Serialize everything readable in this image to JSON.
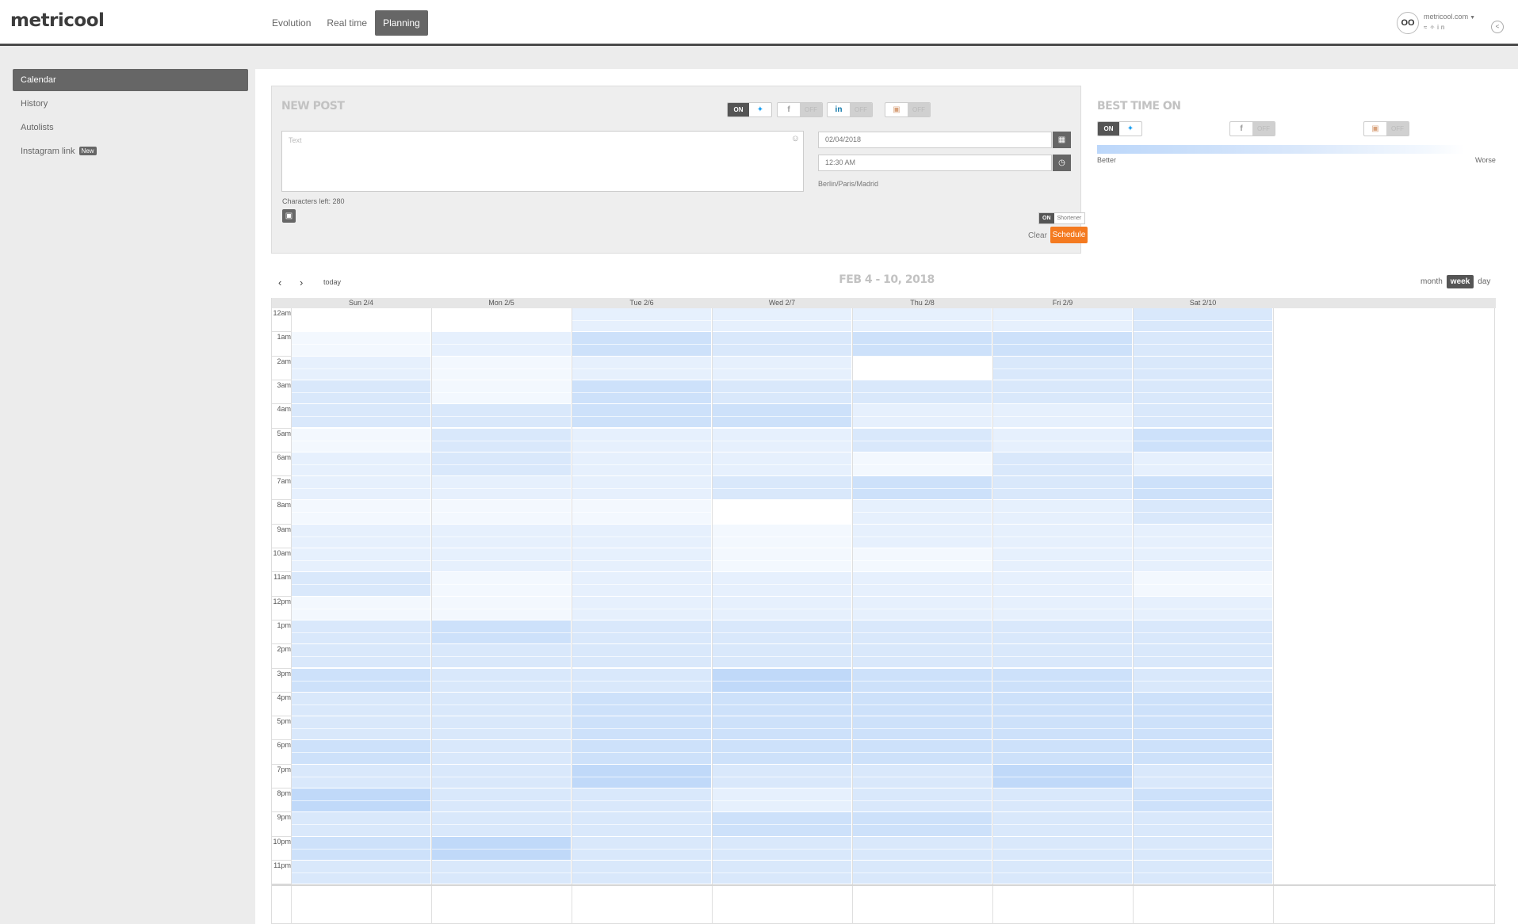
{
  "header": {
    "logo": "metricool",
    "nav": [
      "Evolution",
      "Real time",
      "Planning"
    ],
    "active_nav": "Planning",
    "account": {
      "avatar": "OO",
      "site": "metricool.com",
      "social_icons": "rss twitter linkedin"
    }
  },
  "sidebar": {
    "items": [
      {
        "label": "Calendar",
        "active": true
      },
      {
        "label": "History",
        "active": false
      },
      {
        "label": "Autolists",
        "active": false
      },
      {
        "label": "Instagram link",
        "badge": "New",
        "active": false
      }
    ]
  },
  "new_post": {
    "title": "NEW POST",
    "networks": [
      {
        "name": "twitter",
        "icon": "twitter-icon",
        "state": "ON"
      },
      {
        "name": "facebook",
        "icon": "facebook-icon",
        "state": "OFF"
      },
      {
        "name": "linkedin",
        "icon": "linkedin-icon",
        "state": "OFF"
      },
      {
        "name": "instagram",
        "icon": "instagram-icon",
        "state": "OFF"
      }
    ],
    "text_placeholder": "Text",
    "chars_left": "Characters left: 280",
    "date": "02/04/2018",
    "time": "12:30 AM",
    "timezone": "Berlin/Paris/Madrid",
    "shortener_state": "ON",
    "shortener_label": "Shortener",
    "clear_label": "Clear",
    "schedule_label": "Schedule"
  },
  "best_time": {
    "title": "BEST TIME ON",
    "networks": [
      {
        "name": "twitter",
        "icon": "twitter-icon",
        "state": "ON"
      },
      {
        "name": "facebook",
        "icon": "facebook-icon",
        "state": "OFF"
      },
      {
        "name": "instagram",
        "icon": "instagram-icon",
        "state": "OFF"
      }
    ],
    "better_label": "Better",
    "worse_label": "Worse"
  },
  "calendar": {
    "title": "FEB 4 - 10, 2018",
    "today_label": "today",
    "views": [
      "month",
      "week",
      "day"
    ],
    "active_view": "week",
    "days": [
      "Sun 2/4",
      "Mon 2/5",
      "Tue 2/6",
      "Wed 2/7",
      "Thu 2/8",
      "Fri 2/9",
      "Sat 2/10"
    ],
    "hours": [
      "12am",
      "1am",
      "2am",
      "3am",
      "4am",
      "5am",
      "6am",
      "7am",
      "8am",
      "9am",
      "10am",
      "11am",
      "12pm",
      "1pm",
      "2pm",
      "3pm",
      "4pm",
      "5pm",
      "6pm",
      "7pm",
      "8pm",
      "9pm",
      "10pm",
      "11pm"
    ],
    "heat_colors": [
      "#ffffff",
      "#f3f8fe",
      "#e6f0fd",
      "#d9e8fb",
      "#cde1fa",
      "#c0d9f9"
    ],
    "heat_levels": [
      [
        0,
        1,
        2,
        3,
        3,
        1,
        2,
        2,
        1,
        2,
        2,
        3,
        1,
        3,
        3,
        4,
        3,
        3,
        4,
        3,
        5,
        3,
        4,
        3
      ],
      [
        0,
        2,
        1,
        1,
        3,
        3,
        3,
        2,
        1,
        2,
        2,
        1,
        1,
        4,
        3,
        3,
        3,
        3,
        3,
        3,
        3,
        3,
        5,
        3
      ],
      [
        2,
        4,
        2,
        4,
        4,
        2,
        2,
        2,
        1,
        2,
        2,
        2,
        2,
        3,
        3,
        3,
        4,
        4,
        4,
        5,
        3,
        3,
        3,
        3
      ],
      [
        2,
        3,
        2,
        3,
        4,
        2,
        2,
        3,
        0,
        1,
        1,
        2,
        2,
        3,
        3,
        5,
        4,
        4,
        4,
        3,
        2,
        4,
        3,
        3
      ],
      [
        2,
        4,
        0,
        3,
        2,
        3,
        1,
        4,
        2,
        2,
        1,
        2,
        2,
        3,
        3,
        4,
        4,
        4,
        4,
        3,
        3,
        4,
        3,
        3
      ],
      [
        2,
        4,
        3,
        3,
        2,
        2,
        3,
        3,
        2,
        2,
        2,
        2,
        2,
        3,
        3,
        4,
        4,
        4,
        4,
        5,
        3,
        3,
        3,
        3
      ],
      [
        3,
        3,
        3,
        3,
        3,
        4,
        2,
        4,
        3,
        2,
        2,
        1,
        2,
        3,
        3,
        3,
        4,
        4,
        4,
        3,
        4,
        3,
        3,
        3
      ]
    ]
  }
}
